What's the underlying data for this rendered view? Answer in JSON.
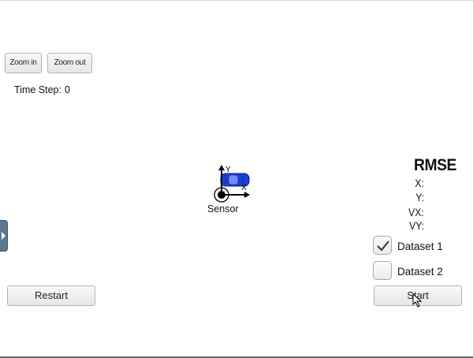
{
  "toolbar": {
    "zoom_in_label": "Zoom in",
    "zoom_out_label": "Zoom out"
  },
  "status": {
    "time_step_label": "Time Step:",
    "time_step_value": "0"
  },
  "scene": {
    "sensor_label": "Sensor",
    "axis_x_label": "X",
    "axis_y_label": "Y",
    "car_color": "#1d3fd6",
    "icons": [
      "car-icon",
      "sensor-icon",
      "axis-arrows-icon"
    ]
  },
  "rmse": {
    "title": "RMSE",
    "x_label": "X:",
    "y_label": "Y:",
    "vx_label": "VX:",
    "vy_label": "VY:"
  },
  "datasets": [
    {
      "label": "Dataset 1",
      "checked": true
    },
    {
      "label": "Dataset 2",
      "checked": false
    }
  ],
  "controls": {
    "restart_label": "Restart",
    "start_label": "Start"
  },
  "colors": {
    "side_tab": "#5d7792",
    "bottom_border": "#6a6a6a"
  }
}
